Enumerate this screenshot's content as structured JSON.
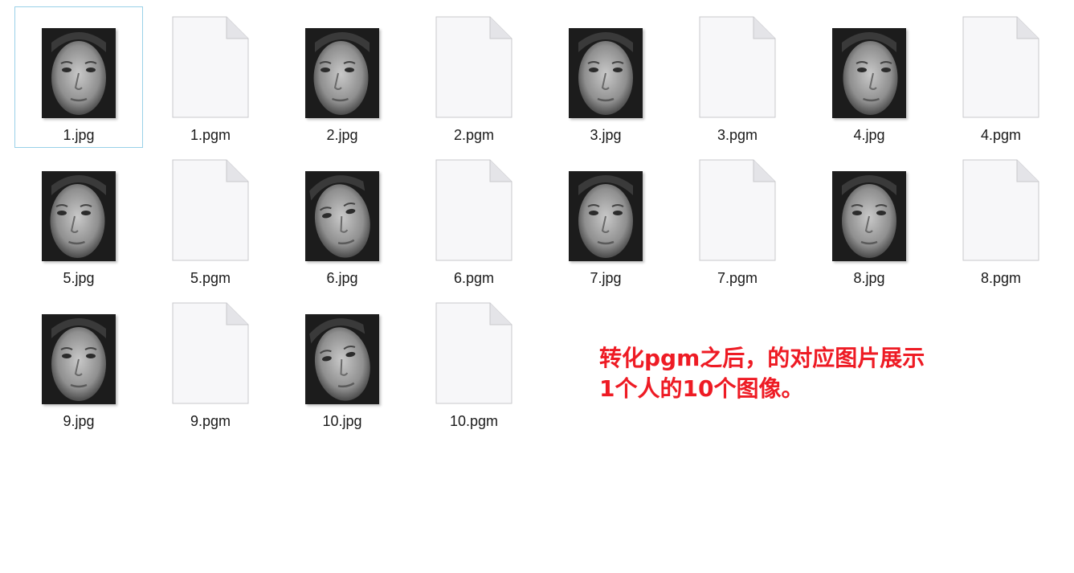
{
  "files": [
    {
      "name": "1.jpg",
      "kind": "image",
      "selected": true,
      "pose": "front"
    },
    {
      "name": "1.pgm",
      "kind": "document"
    },
    {
      "name": "2.jpg",
      "kind": "image",
      "pose": "left"
    },
    {
      "name": "2.pgm",
      "kind": "document"
    },
    {
      "name": "3.jpg",
      "kind": "image",
      "pose": "front"
    },
    {
      "name": "3.pgm",
      "kind": "document"
    },
    {
      "name": "4.jpg",
      "kind": "image",
      "pose": "right"
    },
    {
      "name": "4.pgm",
      "kind": "document"
    },
    {
      "name": "5.jpg",
      "kind": "image",
      "pose": "left"
    },
    {
      "name": "5.pgm",
      "kind": "document"
    },
    {
      "name": "6.jpg",
      "kind": "image",
      "pose": "tilt"
    },
    {
      "name": "6.pgm",
      "kind": "document"
    },
    {
      "name": "7.jpg",
      "kind": "image",
      "pose": "front"
    },
    {
      "name": "7.pgm",
      "kind": "document"
    },
    {
      "name": "8.jpg",
      "kind": "image",
      "pose": "front"
    },
    {
      "name": "8.pgm",
      "kind": "document"
    },
    {
      "name": "9.jpg",
      "kind": "image",
      "pose": "up"
    },
    {
      "name": "9.pgm",
      "kind": "document"
    },
    {
      "name": "10.jpg",
      "kind": "image",
      "pose": "tilt"
    },
    {
      "name": "10.pgm",
      "kind": "document"
    }
  ],
  "annotation": {
    "line1": "转化pgm之后，的对应图片展示",
    "line2": "1个人的10个图像。",
    "color": "#ee1b24"
  },
  "colors": {
    "selection_border": "#99d1e8",
    "doc_fill": "#f7f7f9",
    "doc_border": "#c9c9cc"
  }
}
